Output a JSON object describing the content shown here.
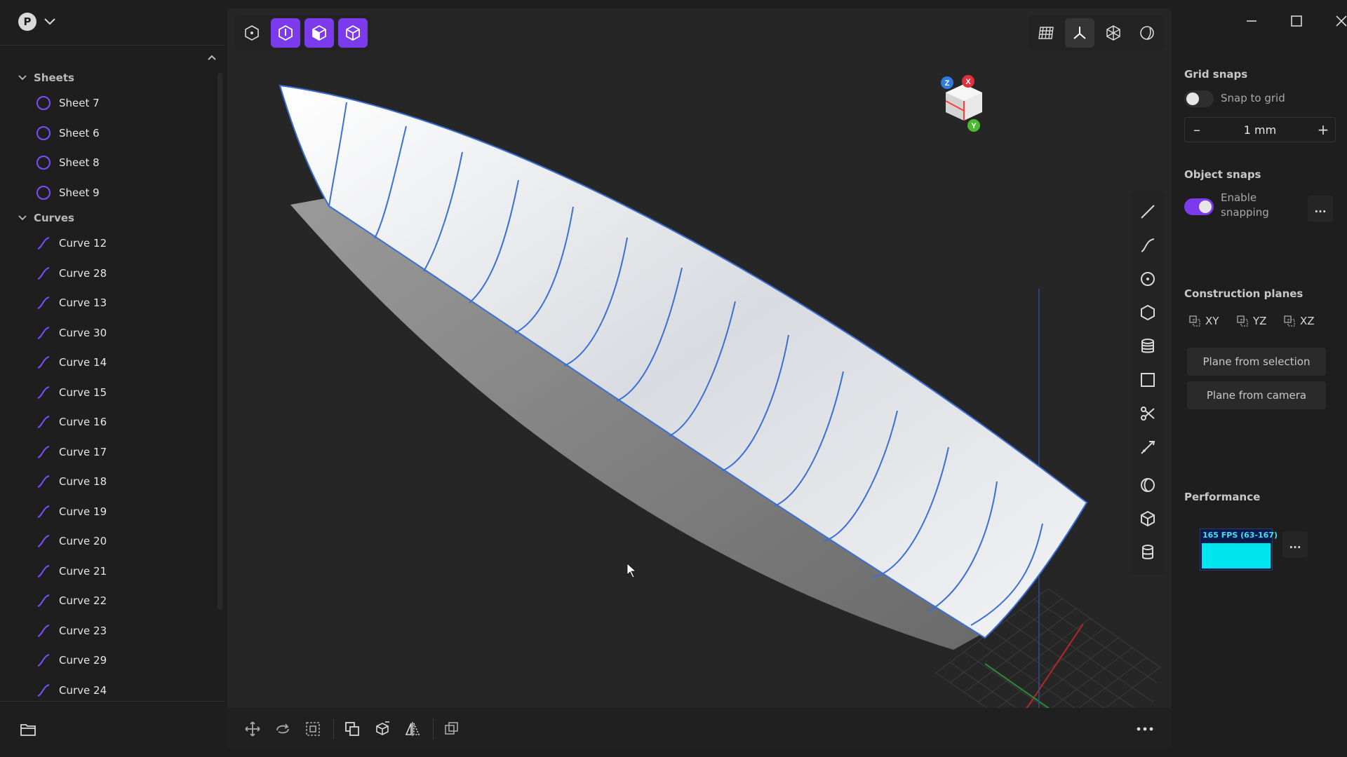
{
  "account": {
    "initial": "P"
  },
  "tree": {
    "sections": [
      {
        "name": "Sheets",
        "type": "sheet",
        "items": [
          "Sheet 7",
          "Sheet 6",
          "Sheet 8",
          "Sheet 9"
        ]
      },
      {
        "name": "Curves",
        "type": "curve",
        "items": [
          "Curve 12",
          "Curve 28",
          "Curve 13",
          "Curve 30",
          "Curve 14",
          "Curve 15",
          "Curve 16",
          "Curve 17",
          "Curve 18",
          "Curve 19",
          "Curve 20",
          "Curve 21",
          "Curve 22",
          "Curve 23",
          "Curve 29",
          "Curve 24"
        ]
      }
    ]
  },
  "gizmo": {
    "x": "X",
    "y": "Y",
    "z": "Z"
  },
  "panel": {
    "grid_snaps": {
      "title": "Grid snaps",
      "snap_label": "Snap to grid",
      "snap_enabled": false,
      "value": "1 mm",
      "minus": "–",
      "plus": "+"
    },
    "object_snaps": {
      "title": "Object snaps",
      "label_line1": "Enable",
      "label_line2": "snapping",
      "enabled": true,
      "more": "..."
    },
    "construction_planes": {
      "title": "Construction planes",
      "planes": [
        "XY",
        "YZ",
        "XZ"
      ],
      "from_selection": "Plane from selection",
      "from_camera": "Plane from camera"
    },
    "performance": {
      "title": "Performance",
      "fps_text": "165 FPS (63-167)",
      "more": "..."
    }
  },
  "colors": {
    "accent": "#7c3aed",
    "curve": "#7c4dff",
    "fps": "#00e6f0"
  }
}
